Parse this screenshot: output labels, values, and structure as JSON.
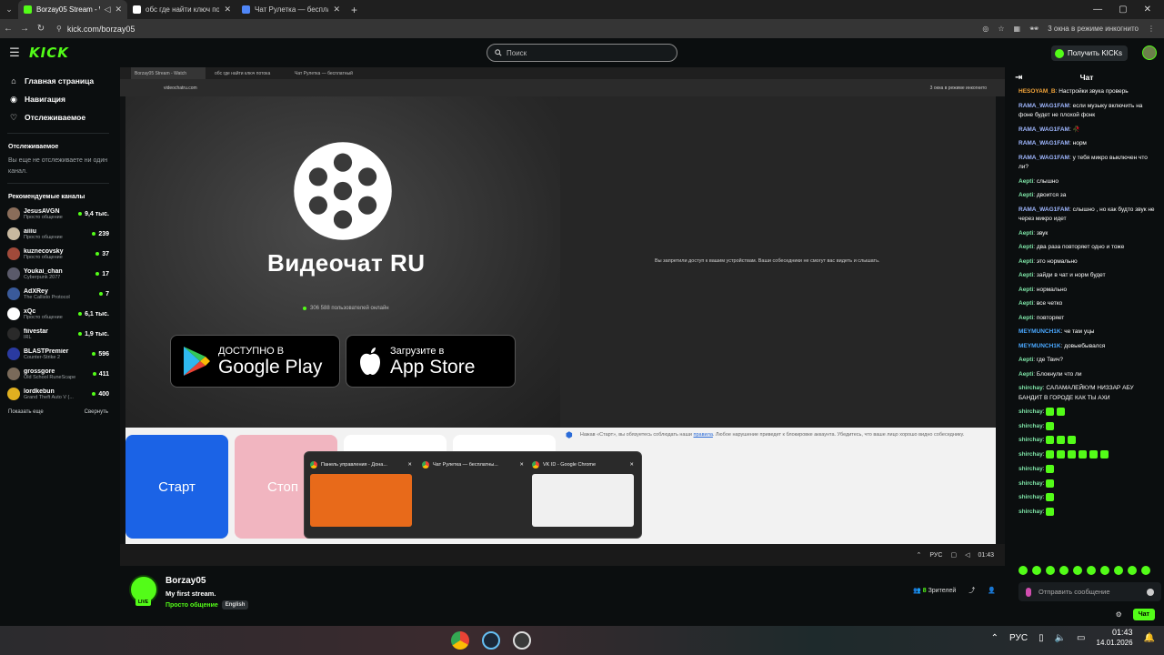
{
  "browser": {
    "tabs": [
      {
        "title": "Borzay05 Stream - Watch",
        "color": "#53fc18",
        "active": true
      },
      {
        "title": "обс где найти ключ потока",
        "color": "#ffffff",
        "active": false
      },
      {
        "title": "Чат Рулетка — бесплатный",
        "color": "#4f86f7",
        "active": false
      }
    ],
    "url": "kick.com/borzay05",
    "incognito_label": "3 окна в режиме инкогнито"
  },
  "header": {
    "logo": "KICK",
    "search_placeholder": "Поиск",
    "get_kicks": "Получить KICKs"
  },
  "sidebar": {
    "main_nav": [
      {
        "label": "Главная страница",
        "icon": "home-icon"
      },
      {
        "label": "Навигация",
        "icon": "compass-icon"
      },
      {
        "label": "Отслеживаемое",
        "icon": "heart-icon"
      }
    ],
    "following_title": "Отслеживаемое",
    "following_empty": "Вы еще не отслеживаете ни один канал.",
    "recommended_title": "Рекомендуемые каналы",
    "channels": [
      {
        "name": "JesusAVGN",
        "category": "Просто общение",
        "viewers": "9,4 тыс.",
        "color": "#8a6d5a"
      },
      {
        "name": "aiiiu",
        "category": "Просто общение",
        "viewers": "239",
        "color": "#c8b9a0"
      },
      {
        "name": "kuznecovsky",
        "category": "Просто общение",
        "viewers": "37",
        "color": "#a04a3a"
      },
      {
        "name": "Youkai_chan",
        "category": "Cyberpunk 2077",
        "viewers": "17",
        "color": "#5a5a6a"
      },
      {
        "name": "AdXRey",
        "category": "The Callisto Protocol",
        "viewers": "7",
        "color": "#3a5a9a"
      },
      {
        "name": "xQc",
        "category": "Просто общение",
        "viewers": "6,1 тыс.",
        "color": "#ffffff"
      },
      {
        "name": "fiivestar",
        "category": "IRL",
        "viewers": "1,9 тыс.",
        "color": "#2a2a2a"
      },
      {
        "name": "BLASTPremier",
        "category": "Counter-Strike 2",
        "viewers": "596",
        "color": "#2a3aa0"
      },
      {
        "name": "grossgore",
        "category": "Old School RuneScape",
        "viewers": "411",
        "color": "#7a6a5a"
      },
      {
        "name": "lordkebun",
        "category": "Grand Theft Auto V (...",
        "viewers": "400",
        "color": "#e0b020"
      }
    ],
    "show_more": "Показать еще",
    "collapse": "Свернуть"
  },
  "player": {
    "inner_tabs": [
      "Borzay05 Stream - Watch",
      "обс где найти ключ потока",
      "Чат Рулетка — бесплатный"
    ],
    "inner_url": "videochatru.com",
    "inner_incognito": "3 окна в режиме инкогнито",
    "vc_title": "Видеочат RU",
    "vc_online": "306 588 пользователей онлайн",
    "google_play_small": "ДОСТУПНО В",
    "google_play_big": "Google Play",
    "app_store_small": "Загрузите в",
    "app_store_big": "App Store",
    "camera_denied": "Вы запретили доступ к вашим устройствам. Ваши собеседники не смогут вас видеть и слышать.",
    "start_btn": "Старт",
    "stop_btn": "Стоп",
    "notice_pre": "Нажав «Старт», вы обязуетесь соблюдать наши",
    "notice_link": "правила",
    "notice_post": ". Любое нарушение приведет к блокировке аккаунта. Убедитесь, что ваше лицо хорошо видно собеседнику.",
    "switcher": [
      {
        "title": "Панель управления - Дона...",
        "thumb": "#e86a1a"
      },
      {
        "title": "Чат Рулетка — бесплатны...",
        "thumb": "#2a2a2a"
      },
      {
        "title": "VK ID - Google Chrome",
        "thumb": "#f0f0f0"
      }
    ],
    "taskbar_lang": "РУС",
    "taskbar_time": "01:43"
  },
  "stream": {
    "streamer": "Borzay05",
    "title": "My first stream.",
    "category": "Просто общение",
    "language": "English",
    "live_badge": "LIVE",
    "viewers_count": "8",
    "viewers_label": "Зрителей"
  },
  "chat": {
    "title": "Чат",
    "messages": [
      {
        "user": "HESOYAM_B",
        "color": "#f2a43a",
        "text": "Настройки звука проверь"
      },
      {
        "user": "RAMA_WAG1FAM",
        "color": "#9fb7ff",
        "text": "если музыку включить на фоне будет не плохой фонк"
      },
      {
        "user": "RAMA_WAG1FAM",
        "color": "#9fb7ff",
        "text": "🥀"
      },
      {
        "user": "RAMA_WAG1FAM",
        "color": "#9fb7ff",
        "text": "норм"
      },
      {
        "user": "RAMA_WAG1FAM",
        "color": "#9fb7ff",
        "text": "у тебя микро выключен что ли?"
      },
      {
        "user": "Aepti",
        "color": "#7fe6a8",
        "text": "слышно"
      },
      {
        "user": "Aepti",
        "color": "#7fe6a8",
        "text": "двоится за"
      },
      {
        "user": "RAMA_WAG1FAM",
        "color": "#9fb7ff",
        "text": "слышно , но как будто звук не через микро идет"
      },
      {
        "user": "Aepti",
        "color": "#7fe6a8",
        "text": "звук"
      },
      {
        "user": "Aepti",
        "color": "#7fe6a8",
        "text": "два раза повторяет одно и тоже"
      },
      {
        "user": "Aepti",
        "color": "#7fe6a8",
        "text": "это нормально"
      },
      {
        "user": "Aepti",
        "color": "#7fe6a8",
        "text": "зайди в чат и норм будет"
      },
      {
        "user": "Aepti",
        "color": "#7fe6a8",
        "text": "нормально"
      },
      {
        "user": "Aepti",
        "color": "#7fe6a8",
        "text": "все четко"
      },
      {
        "user": "Aepti",
        "color": "#7fe6a8",
        "text": "повторяет"
      },
      {
        "user": "MEYMUNCH1K",
        "color": "#4aa8ff",
        "text": "че там уцы"
      },
      {
        "user": "MEYMUNCH1K",
        "color": "#4aa8ff",
        "text": "довыебывался"
      },
      {
        "user": "Aepti",
        "color": "#7fe6a8",
        "text": "где Твич?"
      },
      {
        "user": "Aepti",
        "color": "#7fe6a8",
        "text": "Блокнули что ли"
      },
      {
        "user": "shirchay",
        "color": "#7fe6a8",
        "text": "САЛАМАЛЕЙКУМ НИЗЗАР АБУ БАНДИТ В ГОРОДЕ КАК ТЫ АХИ"
      }
    ],
    "emote_lines": [
      {
        "user": "shirchay",
        "count": 2
      },
      {
        "user": "shirchay",
        "count": 1
      },
      {
        "user": "shirchay",
        "count": 3
      },
      {
        "user": "shirchay",
        "count": 6
      },
      {
        "user": "shirchay",
        "count": 1
      },
      {
        "user": "shirchay",
        "count": 1
      },
      {
        "user": "shirchay",
        "count": 1
      },
      {
        "user": "shirchay",
        "count": 1
      }
    ],
    "input_placeholder": "Отправить сообщение",
    "send_label": "Чат"
  },
  "os_taskbar": {
    "lang": "РУС",
    "time": "01:43",
    "date": "14.01.2026"
  }
}
